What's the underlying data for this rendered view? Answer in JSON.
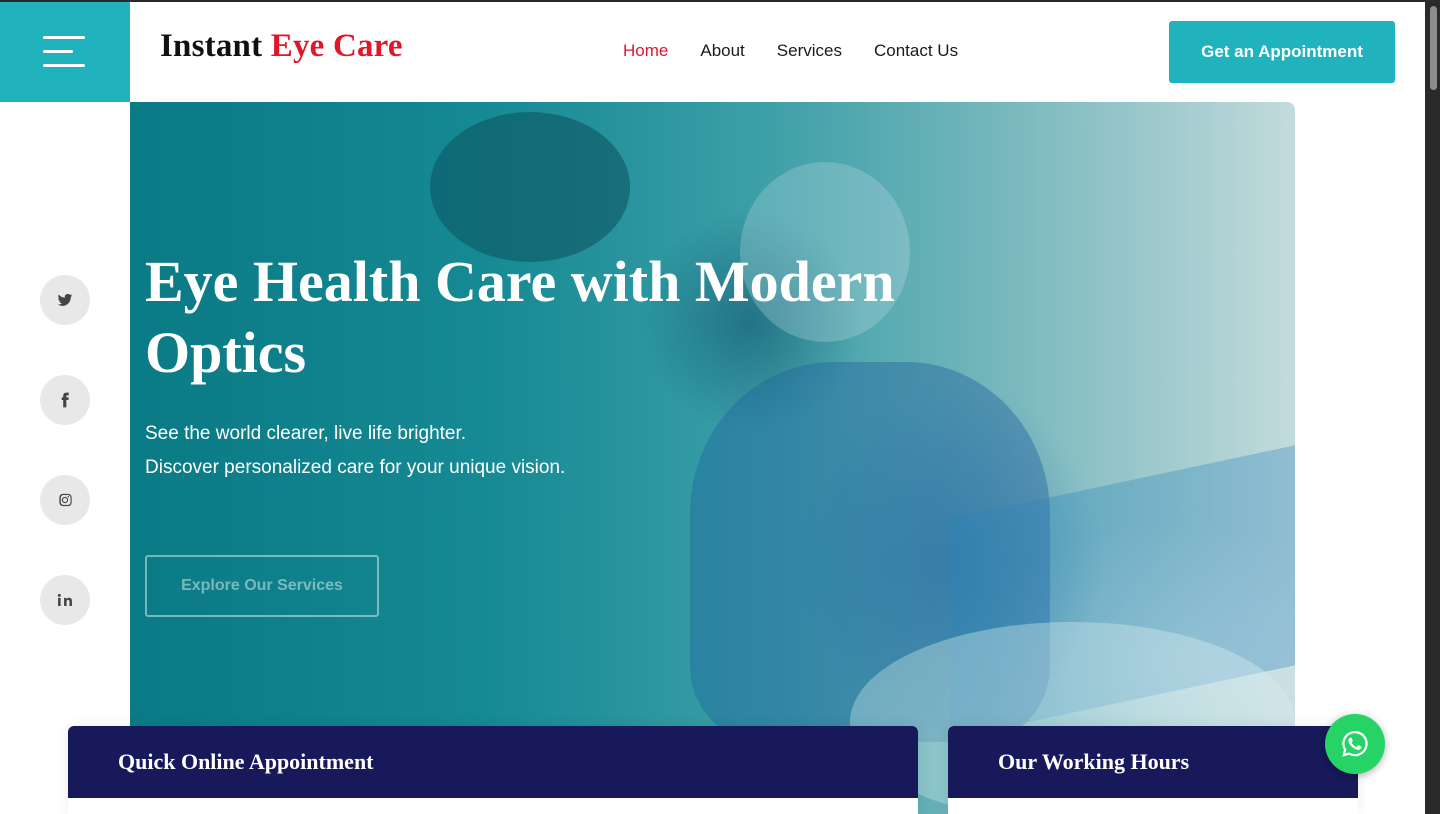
{
  "header": {
    "brand": {
      "prefix": "Instant",
      "accent": "Eye Care"
    },
    "nav": [
      {
        "label": "Home"
      },
      {
        "label": "About"
      },
      {
        "label": "Services"
      },
      {
        "label": "Contact Us"
      }
    ],
    "cta_label": "Get an Appointment"
  },
  "socials": [
    {
      "icon": "twitter-icon"
    },
    {
      "icon": "facebook-icon"
    },
    {
      "icon": "instagram-icon"
    },
    {
      "icon": "linkedin-icon"
    }
  ],
  "hero": {
    "title": "Eye Health Care with Modern Optics",
    "subtitle_lines": [
      "See the world clearer, live life brighter.",
      "Discover personalized care for your unique vision."
    ],
    "button_label": "Explore Our Services"
  },
  "cards": {
    "appointment_title": "Quick Online Appointment",
    "hours_title": "Our Working Hours"
  },
  "colors": {
    "primary": "#21b3bd",
    "accent": "#e0162b",
    "navy": "#17195a",
    "whatsapp": "#25d366"
  }
}
